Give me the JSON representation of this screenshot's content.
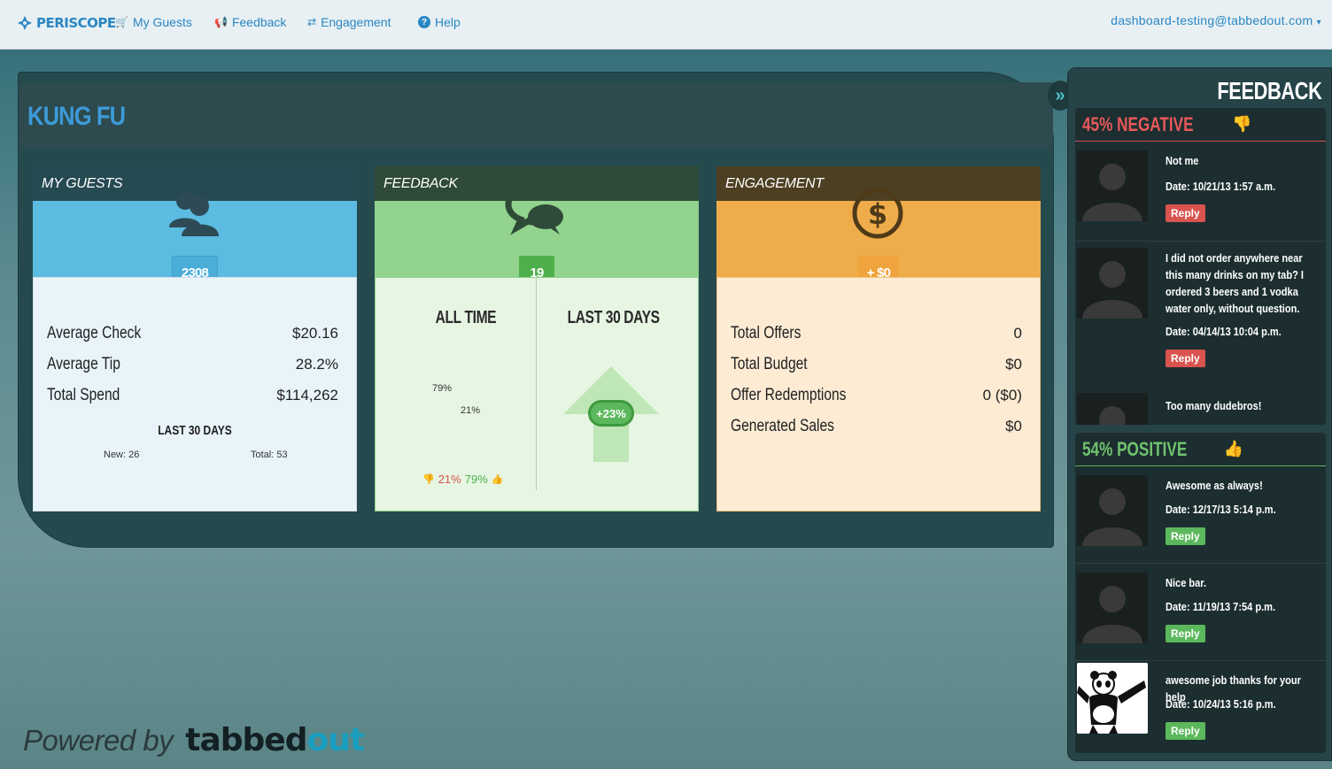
{
  "nav": {
    "brand": "PERISCOPE",
    "items": [
      {
        "label": "My Guests",
        "icon": "cart-icon"
      },
      {
        "label": "Feedback",
        "icon": "megaphone-icon"
      },
      {
        "label": "Engagement",
        "icon": "exchange-icon"
      },
      {
        "label": "Help",
        "icon": "question-icon"
      }
    ],
    "user": "dashboard-testing@tabbedout.com"
  },
  "venue": {
    "title": "KUNG FU"
  },
  "guests": {
    "header": "MY GUESTS",
    "count": "2308",
    "stats": [
      {
        "label": "Average Check",
        "value": "$20.16"
      },
      {
        "label": "Average Tip",
        "value": "28.2%"
      },
      {
        "label": "Total Spend",
        "value": "$114,262"
      }
    ],
    "sub_title": "LAST 30 DAYS",
    "new_label": "New: 26",
    "total_label": "Total: 53"
  },
  "feedback": {
    "header": "FEEDBACK",
    "count": "19",
    "all_time": "ALL TIME",
    "last_30": "LAST 30 DAYS",
    "positive_pct": "79%",
    "negative_pct": "21%",
    "legend_negative": "21%",
    "legend_positive": "79%",
    "trend": "+23%"
  },
  "engagement": {
    "header": "ENGAGEMENT",
    "count": "+ $0",
    "stats": [
      {
        "label": "Total Offers",
        "value": "0"
      },
      {
        "label": "Total Budget",
        "value": "$0"
      },
      {
        "label": "Offer Redemptions",
        "value": "0 ($0)"
      },
      {
        "label": "Generated Sales",
        "value": "$0"
      }
    ]
  },
  "footer": {
    "powered_by": "Powered by",
    "brand_a": "tabbed",
    "brand_b": "out"
  },
  "sidebar": {
    "title": "FEEDBACK",
    "negative": {
      "header": "45% NEGATIVE",
      "items": [
        {
          "text": "Not me",
          "date": "Date: 10/21/13 1:57 a.m.",
          "reply": "Reply"
        },
        {
          "text": "I did not order anywhere near this many drinks on my tab? I ordered 3 beers and 1 vodka water only, without question.",
          "date": "Date: 04/14/13 10:04 p.m.",
          "reply": "Reply"
        },
        {
          "text": "Too many dudebros!"
        }
      ]
    },
    "positive": {
      "header": "54% POSITIVE",
      "items": [
        {
          "text": "Awesome as always!",
          "date": "Date: 12/17/13 5:14 p.m.",
          "reply": "Reply"
        },
        {
          "text": "Nice bar.",
          "date": "Date: 11/19/13 7:54 p.m.",
          "reply": "Reply"
        },
        {
          "text": "awesome job thanks for your help",
          "date": "Date: 10/24/13 5:16 p.m.",
          "reply": "Reply"
        }
      ]
    }
  },
  "colors": {
    "accent": "#2a86c3",
    "guests": "#5bbbe0",
    "feedback": "#92d38e",
    "engagement": "#efac4a",
    "negative": "#e7585a",
    "positive": "#70c36d"
  }
}
